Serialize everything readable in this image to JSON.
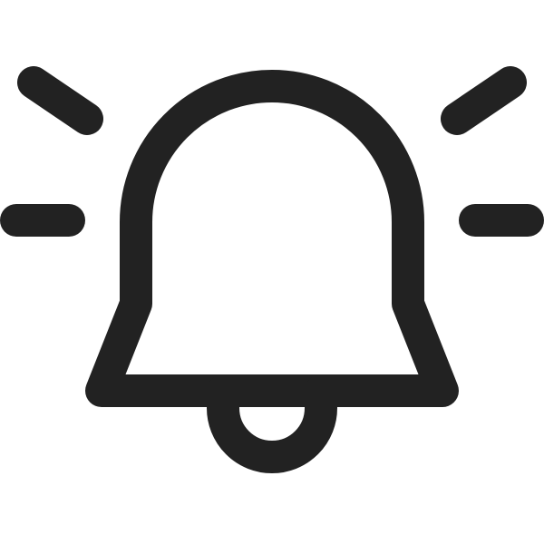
{
  "icon": {
    "name": "bell-ringing-icon",
    "stroke_color": "#222222",
    "background_color": "#ffffff"
  }
}
